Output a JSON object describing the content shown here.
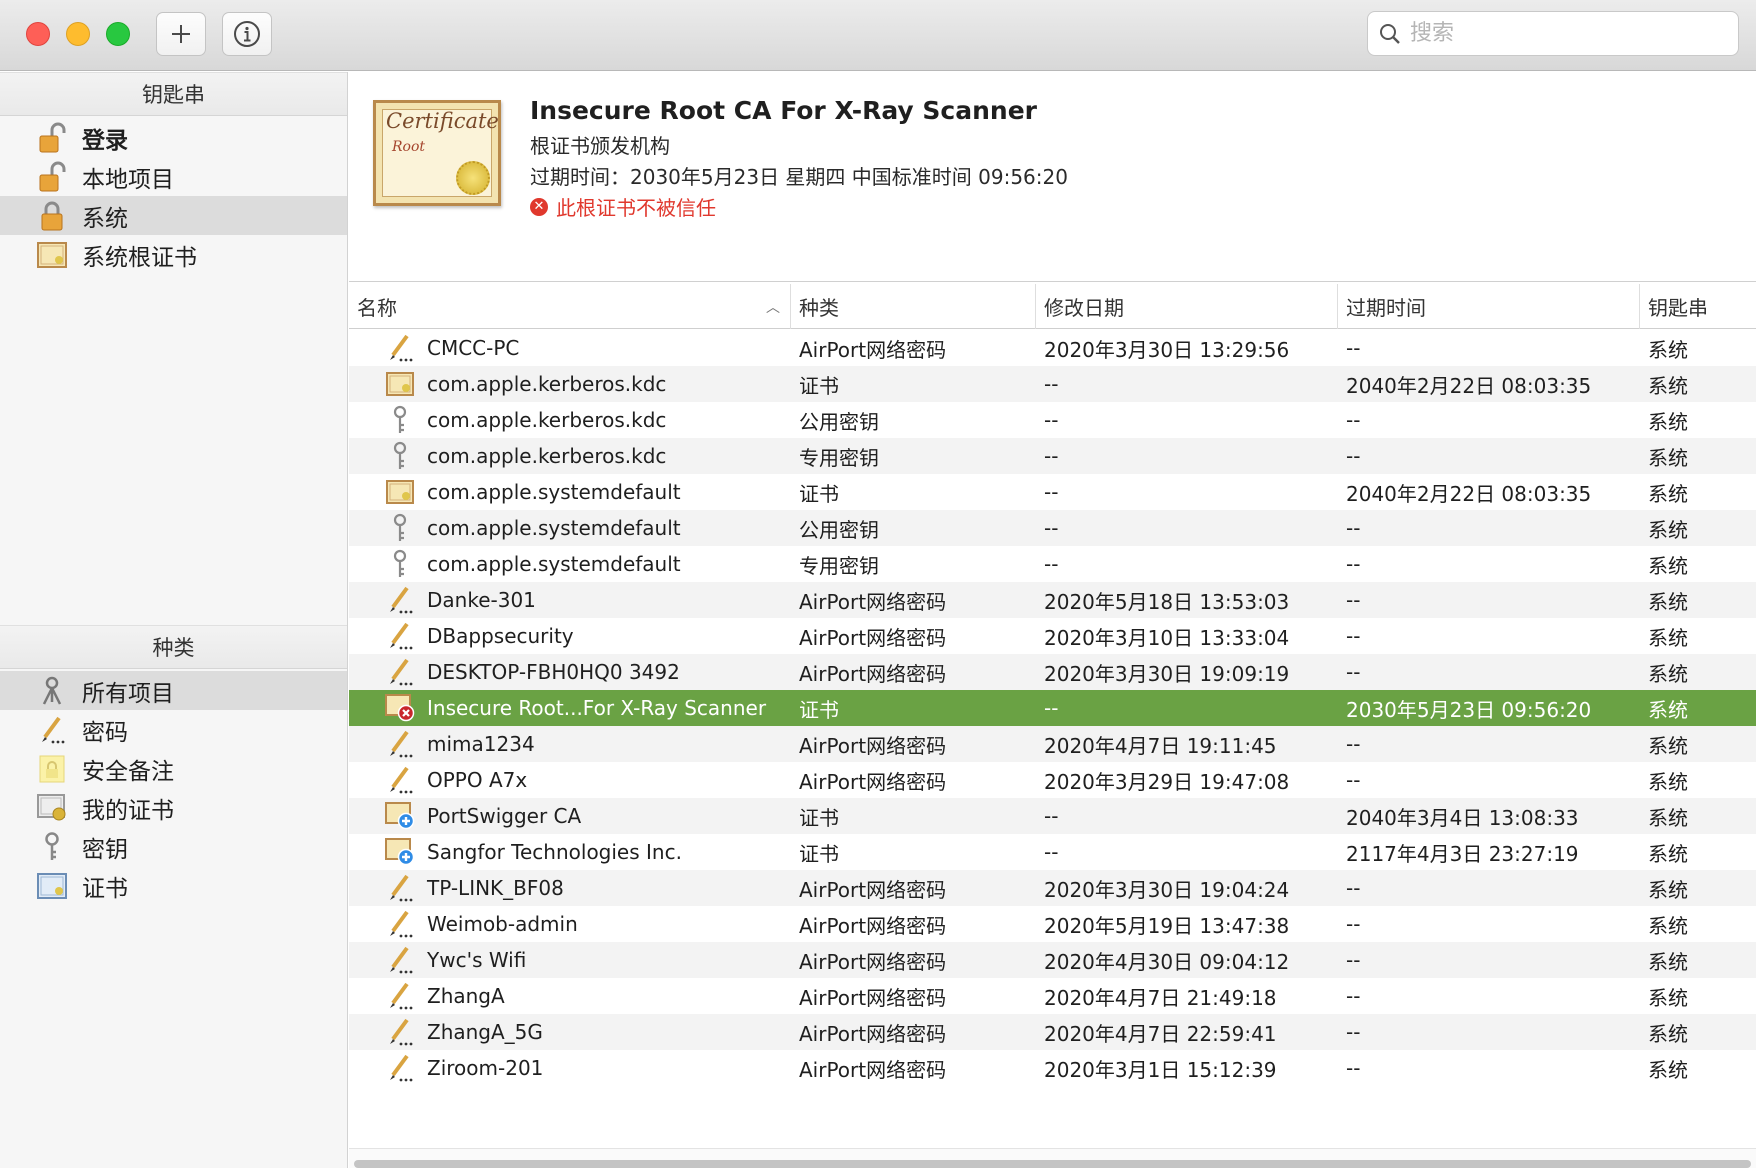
{
  "toolbar": {
    "search_placeholder": "搜索"
  },
  "sidebar": {
    "keychains_header": "钥匙串",
    "keychains": [
      {
        "label": "登录",
        "icon": "lock-open-icon"
      },
      {
        "label": "本地项目",
        "icon": "lock-open-icon"
      },
      {
        "label": "系统",
        "icon": "lock-closed-icon"
      },
      {
        "label": "系统根证书",
        "icon": "certificate-icon"
      }
    ],
    "category_header": "种类",
    "categories": [
      {
        "label": "所有项目",
        "icon": "all-items-icon"
      },
      {
        "label": "密码",
        "icon": "password-pencil-icon"
      },
      {
        "label": "安全备注",
        "icon": "secure-note-icon"
      },
      {
        "label": "我的证书",
        "icon": "my-certificate-icon"
      },
      {
        "label": "密钥",
        "icon": "key-icon"
      },
      {
        "label": "证书",
        "icon": "certificate-icon"
      }
    ]
  },
  "detail": {
    "cert_text_1": "Certificate",
    "cert_text_2": "Root",
    "title": "Insecure Root CA For X-Ray Scanner",
    "kind": "根证书颁发机构",
    "expiry": "过期时间：2030年5月23日 星期四 中国标准时间 09:56:20",
    "warning": "此根证书不被信任"
  },
  "table": {
    "columns": [
      "名称",
      "种类",
      "修改日期",
      "过期时间",
      "钥匙串"
    ],
    "rows": [
      {
        "icon": "password-pencil-icon",
        "name": "CMCC-PC",
        "kind": "AirPort网络密码",
        "modified": "2020年3月30日 13:29:56",
        "expires": "--",
        "keychain": "系统"
      },
      {
        "icon": "certificate-icon",
        "name": "com.apple.kerberos.kdc",
        "kind": "证书",
        "modified": "--",
        "expires": "2040年2月22日 08:03:35",
        "keychain": "系统"
      },
      {
        "icon": "key-icon",
        "name": "com.apple.kerberos.kdc",
        "kind": "公用密钥",
        "modified": "--",
        "expires": "--",
        "keychain": "系统"
      },
      {
        "icon": "key-icon",
        "name": "com.apple.kerberos.kdc",
        "kind": "专用密钥",
        "modified": "--",
        "expires": "--",
        "keychain": "系统"
      },
      {
        "icon": "certificate-icon",
        "name": "com.apple.systemdefault",
        "kind": "证书",
        "modified": "--",
        "expires": "2040年2月22日 08:03:35",
        "keychain": "系统"
      },
      {
        "icon": "key-icon",
        "name": "com.apple.systemdefault",
        "kind": "公用密钥",
        "modified": "--",
        "expires": "--",
        "keychain": "系统"
      },
      {
        "icon": "key-icon",
        "name": "com.apple.systemdefault",
        "kind": "专用密钥",
        "modified": "--",
        "expires": "--",
        "keychain": "系统"
      },
      {
        "icon": "password-pencil-icon",
        "name": "Danke-301",
        "kind": "AirPort网络密码",
        "modified": "2020年5月18日 13:53:03",
        "expires": "--",
        "keychain": "系统"
      },
      {
        "icon": "password-pencil-icon",
        "name": "DBappsecurity",
        "kind": "AirPort网络密码",
        "modified": "2020年3月10日 13:33:04",
        "expires": "--",
        "keychain": "系统"
      },
      {
        "icon": "password-pencil-icon",
        "name": "DESKTOP-FBH0HQ0 3492",
        "kind": "AirPort网络密码",
        "modified": "2020年3月30日 19:09:19",
        "expires": "--",
        "keychain": "系统"
      },
      {
        "icon": "untrusted-certificate-icon",
        "name": "Insecure Root...For X-Ray Scanner",
        "kind": "证书",
        "modified": "--",
        "expires": "2030年5月23日 09:56:20",
        "keychain": "系统",
        "selected": true
      },
      {
        "icon": "password-pencil-icon",
        "name": "mima1234",
        "kind": "AirPort网络密码",
        "modified": "2020年4月7日 19:11:45",
        "expires": "--",
        "keychain": "系统"
      },
      {
        "icon": "password-pencil-icon",
        "name": "OPPO A7x",
        "kind": "AirPort网络密码",
        "modified": "2020年3月29日 19:47:08",
        "expires": "--",
        "keychain": "系统"
      },
      {
        "icon": "custom-trust-certificate-icon",
        "name": "PortSwigger CA",
        "kind": "证书",
        "modified": "--",
        "expires": "2040年3月4日 13:08:33",
        "keychain": "系统"
      },
      {
        "icon": "custom-trust-certificate-icon",
        "name": "Sangfor Technologies Inc.",
        "kind": "证书",
        "modified": "--",
        "expires": "2117年4月3日 23:27:19",
        "keychain": "系统"
      },
      {
        "icon": "password-pencil-icon",
        "name": "TP-LINK_BF08",
        "kind": "AirPort网络密码",
        "modified": "2020年3月30日 19:04:24",
        "expires": "--",
        "keychain": "系统"
      },
      {
        "icon": "password-pencil-icon",
        "name": "Weimob-admin",
        "kind": "AirPort网络密码",
        "modified": "2020年5月19日 13:47:38",
        "expires": "--",
        "keychain": "系统"
      },
      {
        "icon": "password-pencil-icon",
        "name": "Ywc's Wifi",
        "kind": "AirPort网络密码",
        "modified": "2020年4月30日 09:04:12",
        "expires": "--",
        "keychain": "系统"
      },
      {
        "icon": "password-pencil-icon",
        "name": "ZhangA",
        "kind": "AirPort网络密码",
        "modified": "2020年4月7日 21:49:18",
        "expires": "--",
        "keychain": "系统"
      },
      {
        "icon": "password-pencil-icon",
        "name": "ZhangA_5G",
        "kind": "AirPort网络密码",
        "modified": "2020年4月7日 22:59:41",
        "expires": "--",
        "keychain": "系统"
      },
      {
        "icon": "password-pencil-icon",
        "name": "Ziroom-201",
        "kind": "AirPort网络密码",
        "modified": "2020年3月1日 15:12:39",
        "expires": "--",
        "keychain": "系统"
      }
    ]
  },
  "colors": {
    "selection": "#6aa244",
    "warning": "#e0382d"
  }
}
